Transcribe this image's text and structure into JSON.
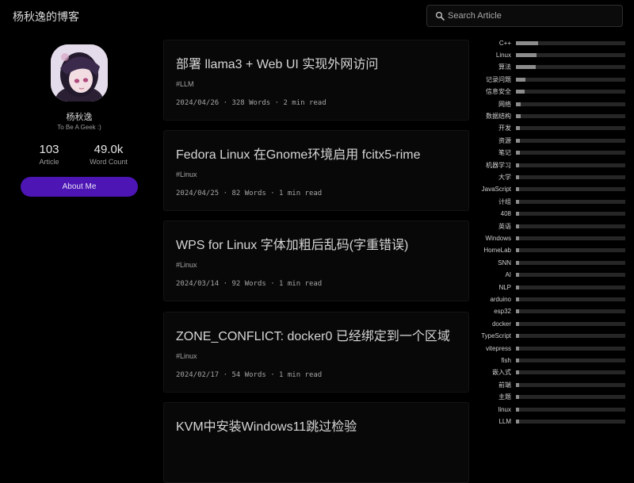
{
  "site": {
    "title": "杨秋逸的博客"
  },
  "search": {
    "placeholder": "Search Article"
  },
  "profile": {
    "name": "杨秋逸",
    "bio": "To Be A Geek :)",
    "stats": [
      {
        "value": "103",
        "label": "Article"
      },
      {
        "value": "49.0k",
        "label": "Word Count"
      }
    ],
    "about_label": "About Me"
  },
  "posts": [
    {
      "title": "部署 llama3 + Web UI 实现外网访问",
      "tag": "#LLM",
      "meta": "2024/04/26 · 328 Words · 2 min read"
    },
    {
      "title": "Fedora Linux 在Gnome环境启用 fcitx5-rime",
      "tag": "#Linux",
      "meta": "2024/04/25 · 82 Words · 1 min read"
    },
    {
      "title": "WPS for Linux 字体加粗后乱码(字重错误)",
      "tag": "#Linux",
      "meta": "2024/03/14 · 92 Words · 1 min read"
    },
    {
      "title": "ZONE_CONFLICT: docker0 已经绑定到一个区域",
      "tag": "#Linux",
      "meta": "2024/02/17 · 54 Words · 1 min read"
    },
    {
      "title": "KVM中安装Windows11跳过检验",
      "tag": "",
      "meta": ""
    }
  ],
  "tags": [
    {
      "name": "C++",
      "level": 0.2
    },
    {
      "name": "Linux",
      "level": 0.19
    },
    {
      "name": "算法",
      "level": 0.18
    },
    {
      "name": "记录问题",
      "level": 0.09
    },
    {
      "name": "信息安全",
      "level": 0.08
    },
    {
      "name": "网络",
      "level": 0.04
    },
    {
      "name": "数据结构",
      "level": 0.04
    },
    {
      "name": "开发",
      "level": 0.035
    },
    {
      "name": "资源",
      "level": 0.035
    },
    {
      "name": "笔记",
      "level": 0.035
    },
    {
      "name": "机器学习",
      "level": 0.03
    },
    {
      "name": "大学",
      "level": 0.03
    },
    {
      "name": "JavaScript",
      "level": 0.025
    },
    {
      "name": "计组",
      "level": 0.025
    },
    {
      "name": "408",
      "level": 0.02
    },
    {
      "name": "英语",
      "level": 0.02
    },
    {
      "name": "Windows",
      "level": 0.02
    },
    {
      "name": "HomeLab",
      "level": 0.02
    },
    {
      "name": "SNN",
      "level": 0.015
    },
    {
      "name": "AI",
      "level": 0.015
    },
    {
      "name": "NLP",
      "level": 0.015
    },
    {
      "name": "arduino",
      "level": 0.015
    },
    {
      "name": "esp32",
      "level": 0.015
    },
    {
      "name": "docker",
      "level": 0.015
    },
    {
      "name": "TypeScript",
      "level": 0.015
    },
    {
      "name": "vitepress",
      "level": 0.015
    },
    {
      "name": "fish",
      "level": 0.015
    },
    {
      "name": "嵌入式",
      "level": 0.015
    },
    {
      "name": "前端",
      "level": 0.015
    },
    {
      "name": "主题",
      "level": 0.015
    },
    {
      "name": "linux",
      "level": 0.015
    },
    {
      "name": "LLM",
      "level": 0.015
    }
  ],
  "colors": {
    "accent": "#4c15b4",
    "bar": "#8c8c8c",
    "track": "#262626",
    "background": "#000000"
  }
}
